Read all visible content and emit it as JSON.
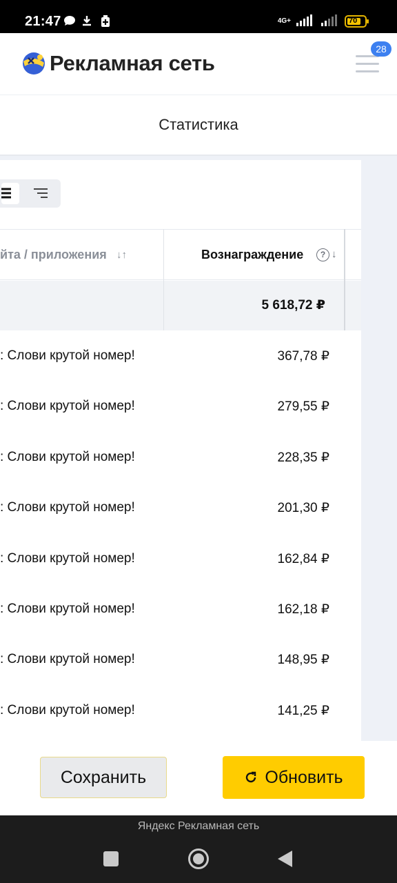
{
  "status_bar": {
    "time": "21:47",
    "network": "4G+",
    "battery": "70",
    "icons": [
      "chat-bubble-icon",
      "download-icon",
      "battery-saver-icon",
      "signal-icon",
      "signal-weak-icon",
      "battery-icon"
    ]
  },
  "header": {
    "brand": "Рекламная сеть",
    "notification_count": "28",
    "icons": [
      "yandex-ad-network-logo-icon",
      "hamburger-menu-icon"
    ]
  },
  "page": {
    "title": "Статистика"
  },
  "table": {
    "columns": {
      "site": "йта / приложения",
      "site_sort": "↓↑",
      "reward": "Вознаграждение",
      "reward_help": "?",
      "reward_sort": "↓"
    },
    "total": "5 618,72 ₽",
    "rows": [
      {
        "name": ": Слови крутой номер!",
        "value": "367,78 ₽"
      },
      {
        "name": ": Слови крутой номер!",
        "value": "279,55 ₽"
      },
      {
        "name": ": Слови крутой номер!",
        "value": "228,35 ₽"
      },
      {
        "name": ": Слови крутой номер!",
        "value": "201,30 ₽"
      },
      {
        "name": ": Слови крутой номер!",
        "value": "162,84 ₽"
      },
      {
        "name": ": Слови крутой номер!",
        "value": "162,18 ₽"
      },
      {
        "name": ": Слови крутой номер!",
        "value": "148,95 ₽"
      },
      {
        "name": ": Слови крутой номер!",
        "value": "141,25 ₽"
      }
    ]
  },
  "actions": {
    "save_label": "Сохранить",
    "refresh_label": "Обновить"
  },
  "nav": {
    "caption": "Яндекс Рекламная сеть"
  },
  "colors": {
    "accent_yellow": "#ffcc00",
    "badge_blue": "#3d80f0",
    "logo_blue": "#3560d6",
    "logo_yellow": "#ffd23a"
  }
}
